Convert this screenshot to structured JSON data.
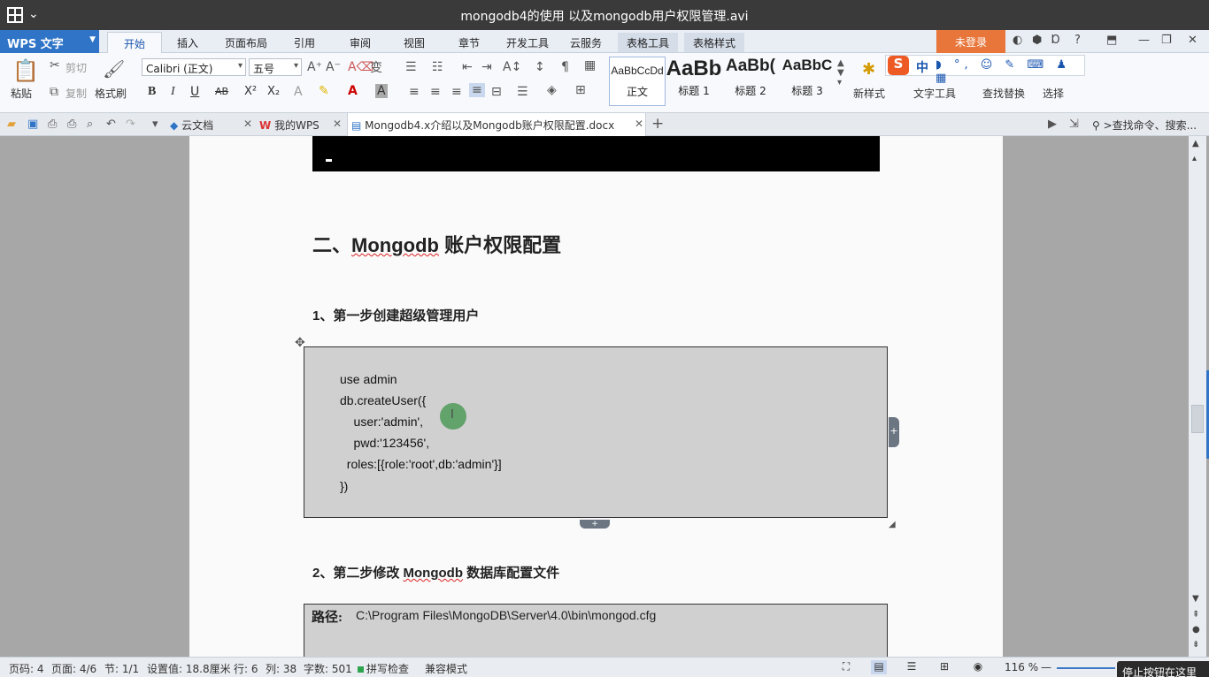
{
  "window": {
    "title": "mongodb4的使用 以及mongodb用户权限管理.avi",
    "chevron": "⌄"
  },
  "ribbon_tabs": {
    "app_button": "WPS 文字",
    "tabs": [
      "开始",
      "插入",
      "页面布局",
      "引用",
      "审阅",
      "视图",
      "章节",
      "开发工具",
      "云服务"
    ],
    "context_tabs": [
      "表格工具",
      "表格样式"
    ],
    "login": "未登录",
    "help": "?"
  },
  "ribbon": {
    "paste": "粘贴",
    "cut": "剪切",
    "copy": "复制",
    "format_painter": "格式刷",
    "font_name": "Calibri (正文)",
    "font_size": "五号",
    "bold": "B",
    "italic": "I",
    "underline": "U",
    "strike": "AB",
    "superscript": "X²",
    "subscript": "X₂",
    "styles": [
      {
        "sample": "AaBbCcDd",
        "name": "正文"
      },
      {
        "sample": "AaBb",
        "name": "标题 1"
      },
      {
        "sample": "AaBb(",
        "name": "标题 2"
      },
      {
        "sample": "AaBbC",
        "name": "标题 3"
      }
    ],
    "new_style": "新样式",
    "text_tools": "文字工具",
    "find_replace": "查找替换",
    "select": "选择"
  },
  "ime": {
    "logo": "S",
    "mode": "中",
    "tools": "◗ °, ☺ ✎ ⌨ ♟ ▦"
  },
  "doc_tabs": {
    "tabs": [
      {
        "label": "云文档"
      },
      {
        "label": "我的WPS"
      },
      {
        "label": "Mongodb4.x介绍以及Mongodb账户权限配置.docx"
      }
    ],
    "add": "+",
    "search_placeholder": ">查找命令、搜索..."
  },
  "document": {
    "heading2": "二、Mongodb 账户权限配置",
    "heading2_prefix": "二、",
    "heading2_word": "Mongodb",
    "heading2_rest": " 账户权限配置",
    "step1": "1、第一步创建超级管理用户",
    "code_lines": [
      "use admin",
      "db.createUser({",
      "    user:'admin',",
      "    pwd:'123456',",
      "  roles:[{role:'root',db:'admin'}]",
      "})"
    ],
    "step2_prefix": "2、第二步修改 ",
    "step2_word": "Mongodb",
    "step2_rest": " 数据库配置文件",
    "path_label": "路径:",
    "path_value": "C:\\Program Files\\MongoDB\\Server\\4.0\\bin\\mongod.cfg"
  },
  "statusbar": {
    "page_code": "页码: 4",
    "page": "页面: 4/6",
    "section": "节: 1/1",
    "setting": "设置值: 18.8厘米",
    "row": "行: 6",
    "col": "列: 38",
    "words": "字数: 501",
    "spell": "拼写检查",
    "compat": "兼容模式",
    "zoom": "116 %",
    "tooltip": "停止按钮在这里"
  }
}
